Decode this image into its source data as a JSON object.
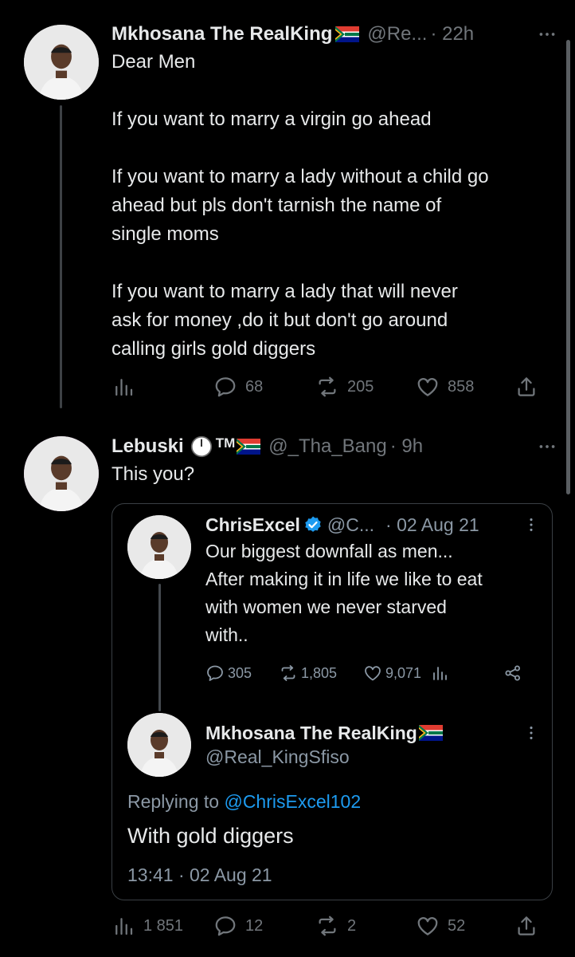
{
  "tweet1": {
    "author": "Mkhosana The RealKing",
    "handle": "@Re...",
    "time": "· 22h",
    "lines": [
      "Dear Men",
      "If you want to marry a virgin go ahead",
      "If you want to marry a lady without a child go",
      "ahead but pls don't tarnish the name of",
      "single moms",
      "If you want to marry a lady that will never",
      "ask for money ,do it but don't go around",
      "calling girls gold diggers"
    ],
    "replies": "68",
    "retweets": "205",
    "likes": "858"
  },
  "tweet2": {
    "author": "Lebuski",
    "tm": "TM",
    "handle": "@_Tha_Bang",
    "time": "· 9h",
    "text": "This you?",
    "views": "1 851",
    "replies": "12",
    "retweets": "2",
    "likes": "52"
  },
  "quote": {
    "author": "ChrisExcel",
    "handle": "@C...",
    "time": "· 02 Aug 21",
    "lines": [
      "Our biggest downfall as men...",
      "After making it in life we like to eat",
      "with women we never starved",
      "with.."
    ],
    "replies": "305",
    "retweets": "1,805",
    "likes": "9,071"
  },
  "reply": {
    "author": "Mkhosana The RealKing",
    "handle": "@Real_KingSfiso",
    "replying_prefix": "Replying to",
    "replying_to": "@ChrisExcel102",
    "text": "With gold diggers",
    "timestamp": "13:41 · 02 Aug 21"
  },
  "colors": {
    "background": "#000000",
    "text": "#e7e9ea",
    "muted": "#71767b",
    "link": "#1d9bf0",
    "verified": "#1d9bf0"
  },
  "icons": [
    "more-icon",
    "views-icon",
    "reply-icon",
    "retweet-icon",
    "like-icon",
    "share-icon",
    "verified-icon",
    "flag-icon",
    "clock-badge-icon",
    "link-share-icon"
  ]
}
